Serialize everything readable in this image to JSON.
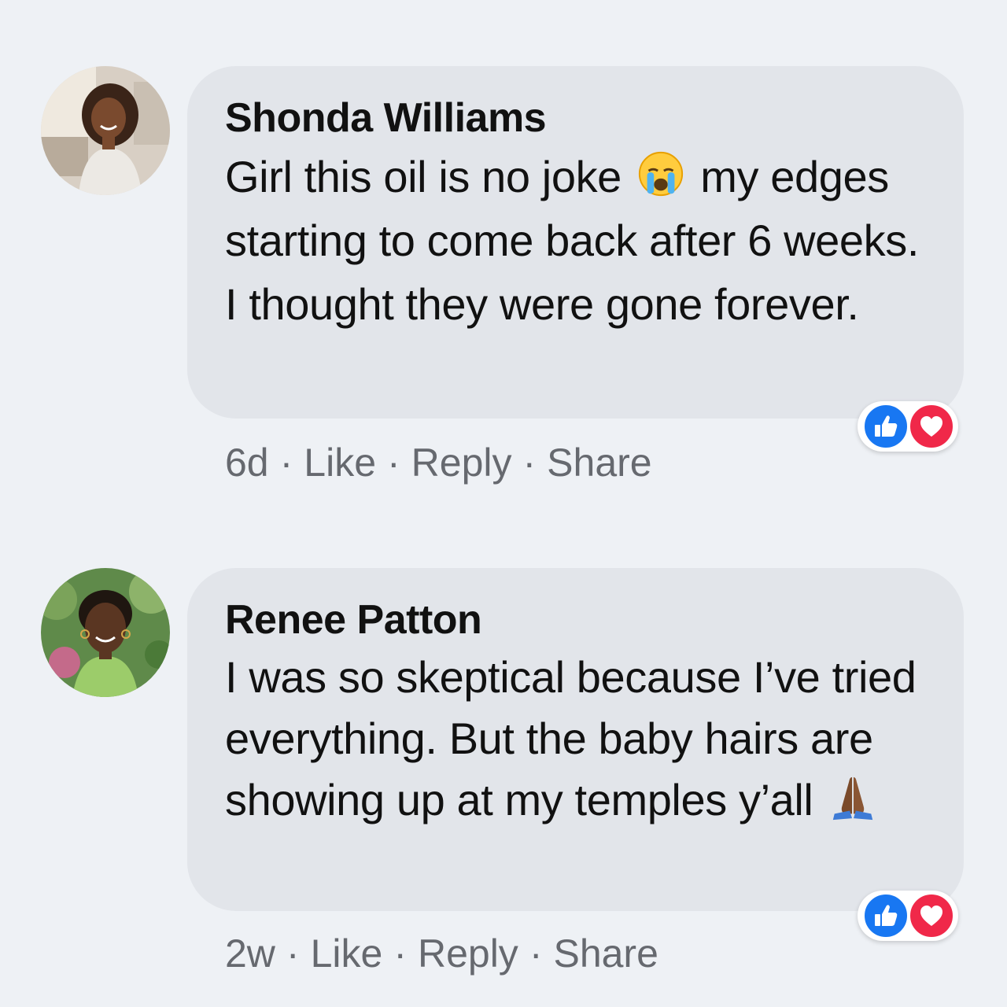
{
  "comments": [
    {
      "author": "Shonda Williams",
      "text_before_emoji": "Girl this oil is no joke",
      "emoji": "loudly-crying-face",
      "text_after_emoji": "my edges starting to come back after 6 weeks. I thought they were gone forever.",
      "time": "6d",
      "actions": {
        "like": "Like",
        "reply": "Reply",
        "share": "Share"
      },
      "reactions": [
        "like",
        "love"
      ]
    },
    {
      "author": "Renee Patton",
      "text_before_emoji": "I was so skeptical because I’ve tried everything. But the baby hairs are showing up at my temples y’all",
      "emoji": "folded-hands",
      "text_after_emoji": "",
      "time": "2w",
      "actions": {
        "like": "Like",
        "reply": "Reply",
        "share": "Share"
      },
      "reactions": [
        "like",
        "love"
      ]
    }
  ],
  "separator": "·",
  "colors": {
    "background": "#eef1f5",
    "bubble": "#e2e5ea",
    "meta_text": "#66696f",
    "like_blue": "#1877f2",
    "love_red": "#f02849"
  }
}
